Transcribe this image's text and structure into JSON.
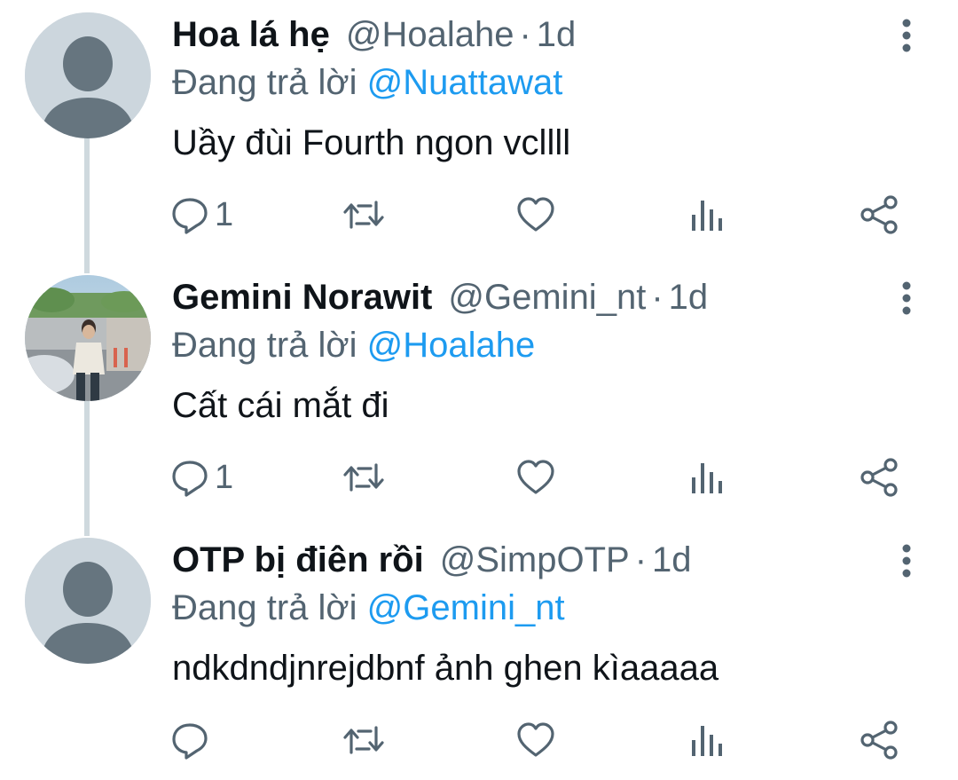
{
  "colors": {
    "link": "#1d9bf0",
    "muted": "#536471",
    "text": "#0f1419",
    "thread": "#cfd9de"
  },
  "tweets": [
    {
      "name": "Hoa lá hẹ",
      "handle": "@Hoalahe",
      "time": "1d",
      "reply_prefix": "Đang trả lời",
      "reply_to": "@Nuattawat",
      "text": "Uầy đùi Fourth ngon vcllll",
      "reply_count": "1",
      "avatar": "default-avatar"
    },
    {
      "name": "Gemini Norawit",
      "handle": "@Gemini_nt",
      "time": "1d",
      "reply_prefix": "Đang trả lời",
      "reply_to": "@Hoalahe",
      "text": "Cất cái mắt đi",
      "reply_count": "1",
      "avatar": "photo-avatar"
    },
    {
      "name": "OTP bị điên rồi",
      "handle": "@SimpOTP",
      "time": "1d",
      "reply_prefix": "Đang trả lời",
      "reply_to": "@Gemini_nt",
      "text": "ndkdndjnrejdbnf ảnh ghen kìaaaaa",
      "reply_count": "",
      "avatar": "default-avatar"
    }
  ],
  "separator": "·",
  "icons": [
    "more-vertical-icon",
    "reply-icon",
    "retweet-icon",
    "like-icon",
    "views-icon",
    "share-icon"
  ]
}
